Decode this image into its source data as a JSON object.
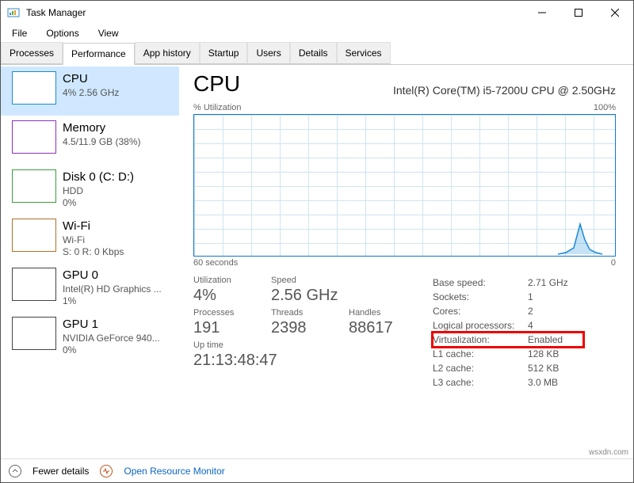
{
  "window": {
    "title": "Task Manager"
  },
  "menu": {
    "file": "File",
    "options": "Options",
    "view": "View"
  },
  "tabs": {
    "processes": "Processes",
    "performance": "Performance",
    "app_history": "App history",
    "startup": "Startup",
    "users": "Users",
    "details": "Details",
    "services": "Services"
  },
  "sidebar": {
    "cpu": {
      "name": "CPU",
      "sub1": "4% 2.56 GHz",
      "color": "#1a8ad6"
    },
    "memory": {
      "name": "Memory",
      "sub1": "4.5/11.9 GB (38%)",
      "color": "#8a2fbd"
    },
    "disk0": {
      "name": "Disk 0 (C: D:)",
      "sub1": "HDD",
      "sub2": "0%",
      "color": "#3a9e3a"
    },
    "wifi": {
      "name": "Wi-Fi",
      "sub1": "Wi-Fi",
      "sub2": "S: 0 R: 0 Kbps",
      "color": "#b0722b"
    },
    "gpu0": {
      "name": "GPU 0",
      "sub1": "Intel(R) HD Graphics ...",
      "sub2": "1%",
      "color": "#444"
    },
    "gpu1": {
      "name": "GPU 1",
      "sub1": "NVIDIA GeForce 940...",
      "sub2": "0%",
      "color": "#444"
    }
  },
  "panel": {
    "title": "CPU",
    "model": "Intel(R) Core(TM) i5-7200U CPU @ 2.50GHz",
    "util_label": "% Utilization",
    "util_max": "100%",
    "x_left": "60 seconds",
    "x_right": "0"
  },
  "stats": {
    "utilization_lbl": "Utilization",
    "utilization_val": "4%",
    "speed_lbl": "Speed",
    "speed_val": "2.56 GHz",
    "processes_lbl": "Processes",
    "processes_val": "191",
    "threads_lbl": "Threads",
    "threads_val": "2398",
    "handles_lbl": "Handles",
    "handles_val": "88617",
    "uptime_lbl": "Up time",
    "uptime_val": "21:13:48:47"
  },
  "info": {
    "base_speed_lbl": "Base speed:",
    "base_speed_val": "2.71 GHz",
    "sockets_lbl": "Sockets:",
    "sockets_val": "1",
    "cores_lbl": "Cores:",
    "cores_val": "2",
    "lprocs_lbl": "Logical processors:",
    "lprocs_val": "4",
    "virt_lbl": "Virtualization:",
    "virt_val": "Enabled",
    "l1_lbl": "L1 cache:",
    "l1_val": "128 KB",
    "l2_lbl": "L2 cache:",
    "l2_val": "512 KB",
    "l3_lbl": "L3 cache:",
    "l3_val": "3.0 MB"
  },
  "footer": {
    "fewer": "Fewer details",
    "resmon": "Open Resource Monitor"
  },
  "watermark": "wsxdn.com",
  "chart_data": {
    "type": "line",
    "title": "% Utilization",
    "xlabel": "seconds",
    "ylabel": "% Utilization",
    "xlim": [
      60,
      0
    ],
    "ylim": [
      0,
      100
    ],
    "x": [
      60,
      55,
      50,
      45,
      40,
      35,
      30,
      25,
      20,
      15,
      10,
      8,
      6,
      5,
      4,
      3,
      2,
      1,
      0
    ],
    "values": [
      2,
      2,
      2,
      2,
      2,
      2,
      2,
      2,
      2,
      2,
      3,
      5,
      8,
      15,
      25,
      12,
      6,
      3,
      2
    ]
  }
}
